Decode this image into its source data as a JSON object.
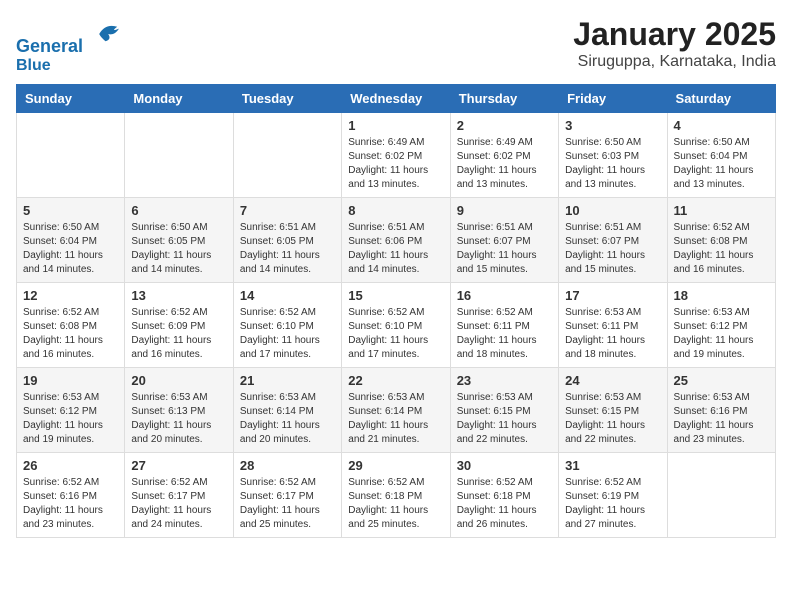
{
  "logo": {
    "line1": "General",
    "line2": "Blue"
  },
  "title": "January 2025",
  "subtitle": "Siruguppa, Karnataka, India",
  "days_of_week": [
    "Sunday",
    "Monday",
    "Tuesday",
    "Wednesday",
    "Thursday",
    "Friday",
    "Saturday"
  ],
  "weeks": [
    [
      {
        "day": "",
        "info": ""
      },
      {
        "day": "",
        "info": ""
      },
      {
        "day": "",
        "info": ""
      },
      {
        "day": "1",
        "info": "Sunrise: 6:49 AM\nSunset: 6:02 PM\nDaylight: 11 hours and 13 minutes."
      },
      {
        "day": "2",
        "info": "Sunrise: 6:49 AM\nSunset: 6:02 PM\nDaylight: 11 hours and 13 minutes."
      },
      {
        "day": "3",
        "info": "Sunrise: 6:50 AM\nSunset: 6:03 PM\nDaylight: 11 hours and 13 minutes."
      },
      {
        "day": "4",
        "info": "Sunrise: 6:50 AM\nSunset: 6:04 PM\nDaylight: 11 hours and 13 minutes."
      }
    ],
    [
      {
        "day": "5",
        "info": "Sunrise: 6:50 AM\nSunset: 6:04 PM\nDaylight: 11 hours and 14 minutes."
      },
      {
        "day": "6",
        "info": "Sunrise: 6:50 AM\nSunset: 6:05 PM\nDaylight: 11 hours and 14 minutes."
      },
      {
        "day": "7",
        "info": "Sunrise: 6:51 AM\nSunset: 6:05 PM\nDaylight: 11 hours and 14 minutes."
      },
      {
        "day": "8",
        "info": "Sunrise: 6:51 AM\nSunset: 6:06 PM\nDaylight: 11 hours and 14 minutes."
      },
      {
        "day": "9",
        "info": "Sunrise: 6:51 AM\nSunset: 6:07 PM\nDaylight: 11 hours and 15 minutes."
      },
      {
        "day": "10",
        "info": "Sunrise: 6:51 AM\nSunset: 6:07 PM\nDaylight: 11 hours and 15 minutes."
      },
      {
        "day": "11",
        "info": "Sunrise: 6:52 AM\nSunset: 6:08 PM\nDaylight: 11 hours and 16 minutes."
      }
    ],
    [
      {
        "day": "12",
        "info": "Sunrise: 6:52 AM\nSunset: 6:08 PM\nDaylight: 11 hours and 16 minutes."
      },
      {
        "day": "13",
        "info": "Sunrise: 6:52 AM\nSunset: 6:09 PM\nDaylight: 11 hours and 16 minutes."
      },
      {
        "day": "14",
        "info": "Sunrise: 6:52 AM\nSunset: 6:10 PM\nDaylight: 11 hours and 17 minutes."
      },
      {
        "day": "15",
        "info": "Sunrise: 6:52 AM\nSunset: 6:10 PM\nDaylight: 11 hours and 17 minutes."
      },
      {
        "day": "16",
        "info": "Sunrise: 6:52 AM\nSunset: 6:11 PM\nDaylight: 11 hours and 18 minutes."
      },
      {
        "day": "17",
        "info": "Sunrise: 6:53 AM\nSunset: 6:11 PM\nDaylight: 11 hours and 18 minutes."
      },
      {
        "day": "18",
        "info": "Sunrise: 6:53 AM\nSunset: 6:12 PM\nDaylight: 11 hours and 19 minutes."
      }
    ],
    [
      {
        "day": "19",
        "info": "Sunrise: 6:53 AM\nSunset: 6:12 PM\nDaylight: 11 hours and 19 minutes."
      },
      {
        "day": "20",
        "info": "Sunrise: 6:53 AM\nSunset: 6:13 PM\nDaylight: 11 hours and 20 minutes."
      },
      {
        "day": "21",
        "info": "Sunrise: 6:53 AM\nSunset: 6:14 PM\nDaylight: 11 hours and 20 minutes."
      },
      {
        "day": "22",
        "info": "Sunrise: 6:53 AM\nSunset: 6:14 PM\nDaylight: 11 hours and 21 minutes."
      },
      {
        "day": "23",
        "info": "Sunrise: 6:53 AM\nSunset: 6:15 PM\nDaylight: 11 hours and 22 minutes."
      },
      {
        "day": "24",
        "info": "Sunrise: 6:53 AM\nSunset: 6:15 PM\nDaylight: 11 hours and 22 minutes."
      },
      {
        "day": "25",
        "info": "Sunrise: 6:53 AM\nSunset: 6:16 PM\nDaylight: 11 hours and 23 minutes."
      }
    ],
    [
      {
        "day": "26",
        "info": "Sunrise: 6:52 AM\nSunset: 6:16 PM\nDaylight: 11 hours and 23 minutes."
      },
      {
        "day": "27",
        "info": "Sunrise: 6:52 AM\nSunset: 6:17 PM\nDaylight: 11 hours and 24 minutes."
      },
      {
        "day": "28",
        "info": "Sunrise: 6:52 AM\nSunset: 6:17 PM\nDaylight: 11 hours and 25 minutes."
      },
      {
        "day": "29",
        "info": "Sunrise: 6:52 AM\nSunset: 6:18 PM\nDaylight: 11 hours and 25 minutes."
      },
      {
        "day": "30",
        "info": "Sunrise: 6:52 AM\nSunset: 6:18 PM\nDaylight: 11 hours and 26 minutes."
      },
      {
        "day": "31",
        "info": "Sunrise: 6:52 AM\nSunset: 6:19 PM\nDaylight: 11 hours and 27 minutes."
      },
      {
        "day": "",
        "info": ""
      }
    ]
  ]
}
